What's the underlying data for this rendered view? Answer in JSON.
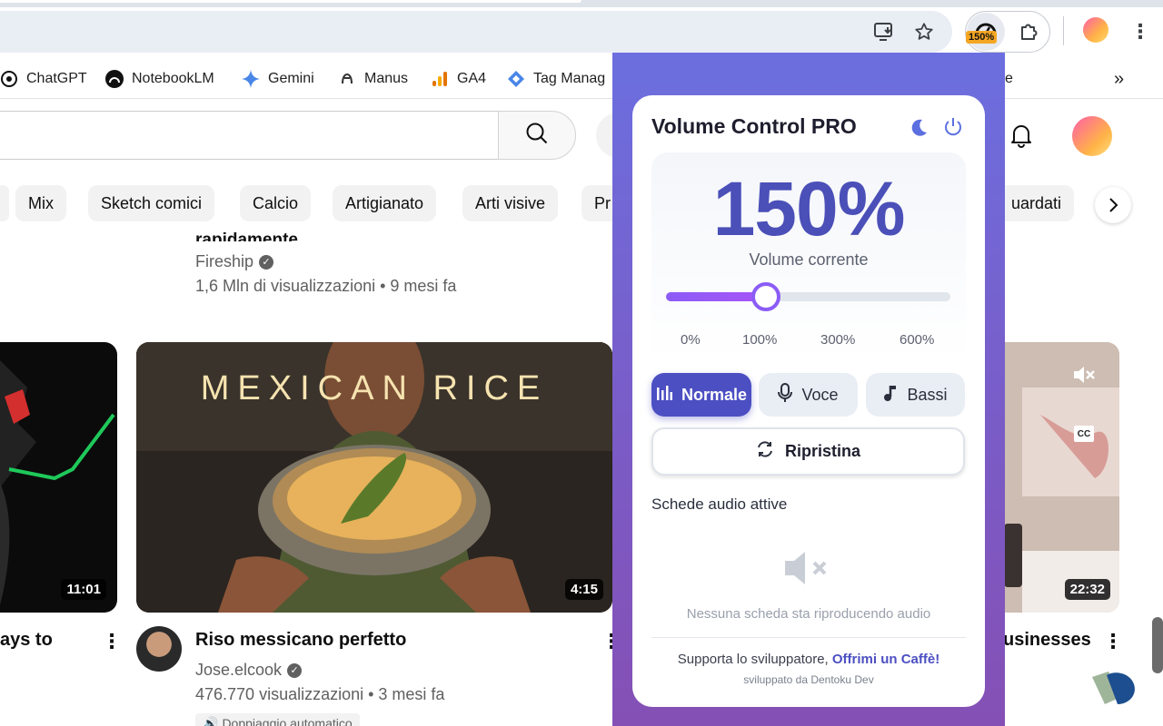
{
  "browser": {
    "extension_badge": "150%",
    "bookmarks": [
      {
        "label": "ChatGPT",
        "icon": "chatgpt-icon"
      },
      {
        "label": "NotebookLM",
        "icon": "notebooklm-icon"
      },
      {
        "label": "Gemini",
        "icon": "gemini-icon"
      },
      {
        "label": "Manus",
        "icon": "manus-icon"
      },
      {
        "label": "GA4",
        "icon": "ga4-icon"
      },
      {
        "label": "Tag Manag",
        "icon": "tag-manager-icon"
      }
    ],
    "bookmarks_overflow_fragment": "e",
    "bookmarks_more": "»"
  },
  "youtube": {
    "chips": [
      "Mix",
      "Sketch comici",
      "Calcio",
      "Artigianato",
      "Arti visive",
      "Pr",
      "uardati"
    ],
    "top_video": {
      "title_fragment": "rapidamente",
      "channel": "Fireship",
      "stats": "1,6 Mln di visualizzazioni • 9 mesi fa"
    },
    "left_video": {
      "duration": "11:01",
      "title_fragment": "ays to"
    },
    "main_video": {
      "thumb_text": "MEXICAN RICE",
      "duration": "4:15",
      "title": "Riso messicano perfetto",
      "channel": "Jose.elcook",
      "stats": "476.770 visualizzazioni • 3 mesi fa",
      "badge": "Doppiaggio automatico"
    },
    "right_video": {
      "duration": "22:32",
      "title_fragment": "usinesses",
      "cc_label": "CC"
    }
  },
  "popup": {
    "title": "Volume Control PRO",
    "volume_display": "150%",
    "volume_caption": "Volume corrente",
    "volume_percent": 150,
    "slider_min": 0,
    "slider_max": 600,
    "ticks": [
      "0%",
      "100%",
      "300%",
      "600%"
    ],
    "modes": [
      {
        "label": "Normale",
        "icon": "equalizer-icon",
        "active": true
      },
      {
        "label": "Voce",
        "icon": "microphone-icon",
        "active": false
      },
      {
        "label": "Bassi",
        "icon": "music-note-icon",
        "active": false
      }
    ],
    "reset_label": "Ripristina",
    "active_tabs_heading": "Schede audio attive",
    "empty_state": "Nessuna scheda sta riproducendo audio",
    "support_text": "Supporta lo sviluppatore,",
    "support_link": "Offrimi un Caffè!",
    "credit": "sviluppato da Dentoku Dev",
    "accent": "#4c4fc2",
    "slider_color": "#8b5cf6"
  }
}
